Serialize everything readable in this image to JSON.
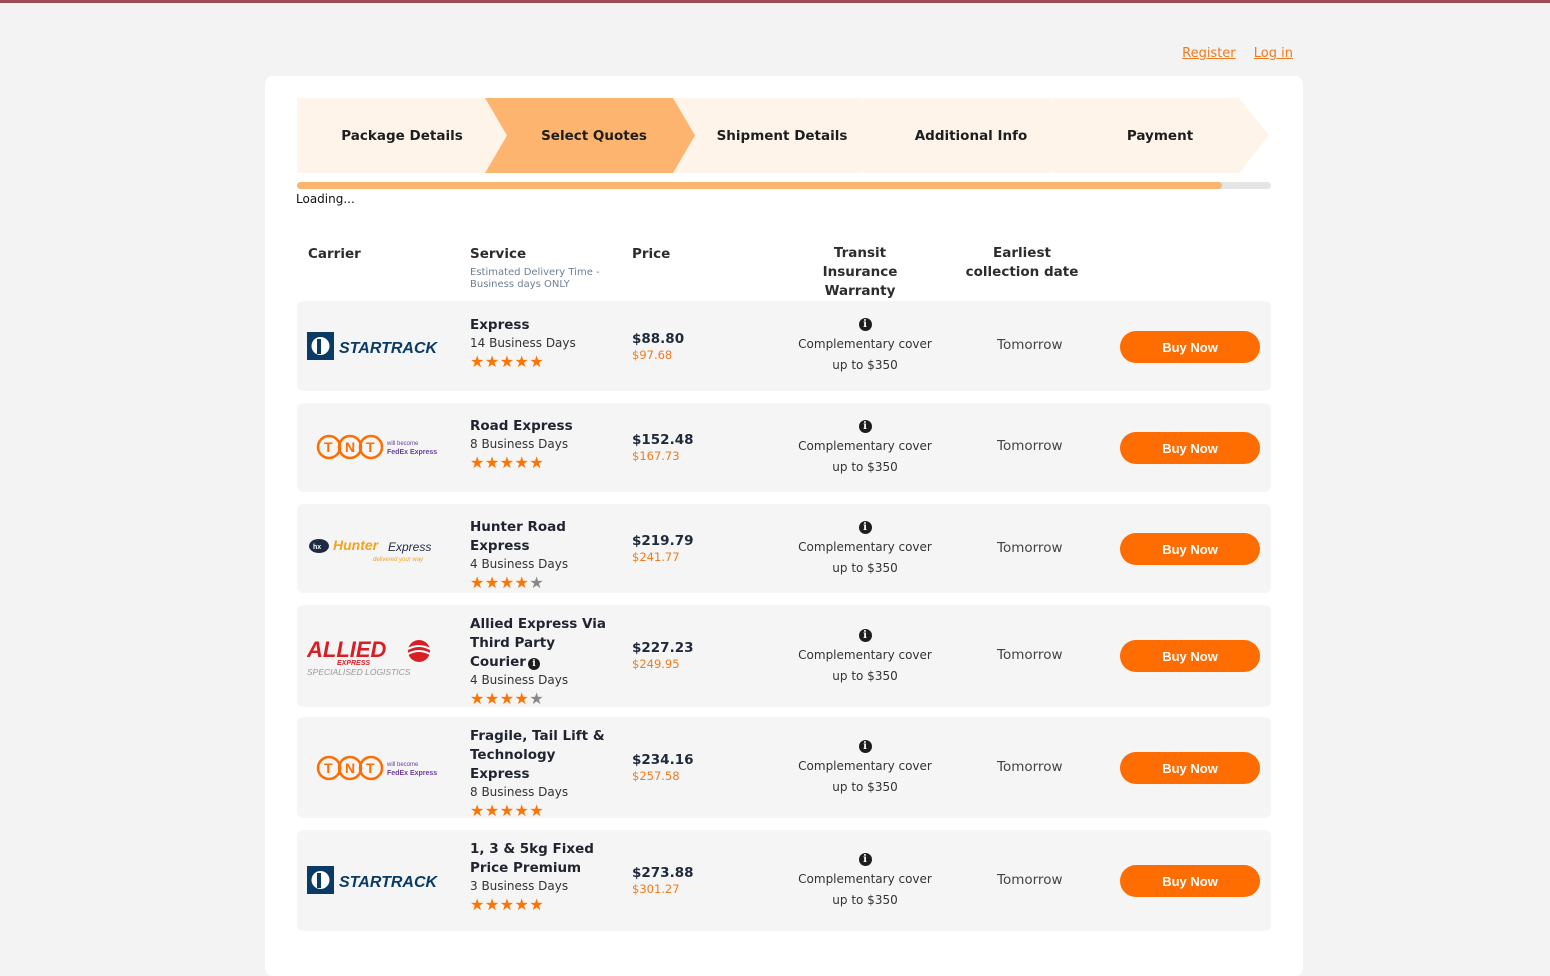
{
  "links": {
    "register": "Register",
    "login": "Log in"
  },
  "steps": [
    "Package Details",
    "Select Quotes",
    "Shipment Details",
    "Additional Info",
    "Payment"
  ],
  "active_step": 1,
  "progress": 0.95,
  "loading_text": "Loading...",
  "headers": {
    "carrier": "Carrier",
    "service": "Service",
    "service_sub": "Estimated Delivery Time - Business days ONLY",
    "price": "Price",
    "insurance": "Transit Insurance Warranty",
    "collection": "Earliest collection date"
  },
  "quotes": [
    {
      "carrier": "StarTrack",
      "logo_text": "STARTRACK",
      "service": "Express",
      "days": "14 Business Days",
      "rating": 5,
      "price": "$88.80",
      "old_price": "$97.68",
      "insurance_line1": "Complementary cover",
      "insurance_line2": "up to $350",
      "collection": "Tomorrow",
      "button": "Buy Now",
      "stars_text": "★★★★★"
    },
    {
      "carrier": "TNT",
      "logo_text": "TNT",
      "logo_sub1": "will become",
      "logo_sub2": "FedEx Express",
      "service": "Road Express",
      "days": "8 Business Days",
      "rating": 5,
      "price": "$152.48",
      "old_price": "$167.73",
      "insurance_line1": "Complementary cover",
      "insurance_line2": "up to $350",
      "collection": "Tomorrow",
      "button": "Buy Now",
      "stars_text": "★★★★★"
    },
    {
      "carrier": "Hunter Express",
      "logo_text": "Hunter",
      "logo_text2": "Express",
      "logo_sub": "delivered your way",
      "service": "Hunter Road Express",
      "days": "4 Business Days",
      "rating": 4.5,
      "price": "$219.79",
      "old_price": "$241.77",
      "insurance_line1": "Complementary cover",
      "insurance_line2": "up to $350",
      "collection": "Tomorrow",
      "button": "Buy Now",
      "stars_text": "★★★★★"
    },
    {
      "carrier": "Allied Express",
      "logo_text": "ALLIED",
      "logo_sub1": "EXPRESS",
      "logo_sub2": "SPECIALISED LOGISTICS",
      "service": "Allied Express Via Third Party Courier",
      "days": "4 Business Days",
      "rating": 4.5,
      "price": "$227.23",
      "old_price": "$249.95",
      "insurance_line1": "Complementary cover",
      "insurance_line2": "up to $350",
      "collection": "Tomorrow",
      "button": "Buy Now",
      "stars_text": "★★★★★"
    },
    {
      "carrier": "TNT",
      "logo_text": "TNT",
      "logo_sub1": "will become",
      "logo_sub2": "FedEx Express",
      "service": "Fragile, Tail Lift & Technology Express",
      "days": "8 Business Days",
      "rating": 5,
      "price": "$234.16",
      "old_price": "$257.58",
      "insurance_line1": "Complementary cover",
      "insurance_line2": "up to $350",
      "collection": "Tomorrow",
      "button": "Buy Now",
      "stars_text": "★★★★★"
    },
    {
      "carrier": "StarTrack",
      "logo_text": "STARTRACK",
      "service": "1, 3 & 5kg Fixed Price Premium",
      "days": "3 Business Days",
      "rating": 5,
      "price": "$273.88",
      "old_price": "$301.27",
      "insurance_line1": "Complementary cover",
      "insurance_line2": "up to $350",
      "collection": "Tomorrow",
      "button": "Buy Now",
      "stars_text": "★★★★★"
    }
  ],
  "colors": {
    "accent": "#ff6d00",
    "step_active": "#fdb46f",
    "step_inactive": "#fff4ea",
    "price_old": "#f07a1d"
  }
}
